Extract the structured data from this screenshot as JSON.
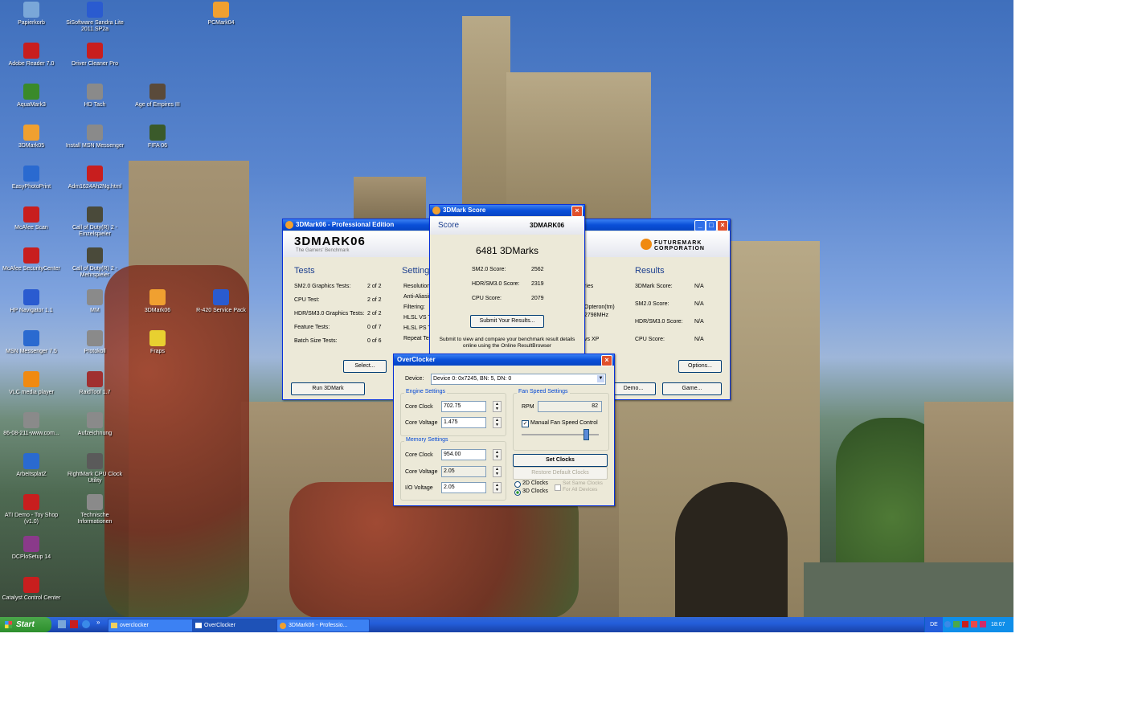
{
  "desktop": {
    "icons": [
      {
        "label": "Papierkorb",
        "color": "#7aa7d8"
      },
      {
        "label": "SiSoftware Sandra Lite 2011.SP2a",
        "color": "#2a5bd0"
      },
      {
        "label": "PCMark04",
        "color": "#f0a030"
      },
      {
        "label": "Adobe Reader 7.0",
        "color": "#c81e1e"
      },
      {
        "label": "Driver Cleaner Pro",
        "color": "#c81e1e"
      },
      {
        "label": "AquaMark3",
        "color": "#3a8a2a"
      },
      {
        "label": "HD Tach",
        "color": "#8a8a8a"
      },
      {
        "label": "Age of Empires III",
        "color": "#5a4a3a"
      },
      {
        "label": "3DMark05",
        "color": "#f0a030"
      },
      {
        "label": "Install MSN Messenger",
        "color": "#8a8a8a"
      },
      {
        "label": "FIFA 06",
        "color": "#3a5a2a"
      },
      {
        "label": "EasyPhotoPrint",
        "color": "#2a6ad0"
      },
      {
        "label": "Adm1624Ah2Ng.html",
        "color": "#c81e1e"
      },
      {
        "label": "McAfee Scan",
        "color": "#c81e1e"
      },
      {
        "label": "Call of Duty(R) 2 - Einzelspieler",
        "color": "#4a4a3a"
      },
      {
        "label": "McAfee SecurityCenter",
        "color": "#c81e1e"
      },
      {
        "label": "Call of Duty(R) 2 - Mehrspieler",
        "color": "#4a4a3a"
      },
      {
        "label": "3DMark06",
        "color": "#f0a030"
      },
      {
        "label": "R-420 Service Pack",
        "color": "#2a5bd0"
      },
      {
        "label": "HP Navigator 1.1",
        "color": "#2a5bd0"
      },
      {
        "label": "MM",
        "color": "#8a8a8a"
      },
      {
        "label": "Fraps",
        "color": "#e8d030"
      },
      {
        "label": "MSN Messenger 7.5",
        "color": "#2a6ad0"
      },
      {
        "label": "Protokoll",
        "color": "#8a8a8a"
      },
      {
        "label": "VLC media player",
        "color": "#f08a10"
      },
      {
        "label": "RaidTool 1.7",
        "color": "#a03030"
      },
      {
        "label": "86-08-211-www.com...",
        "color": "#8a8a8a"
      },
      {
        "label": "Aufzeichnung",
        "color": "#8a8a8a"
      },
      {
        "label": "ArbeitsplatZ",
        "color": "#2a6ad0"
      },
      {
        "label": "RightMark CPU Clock Utility",
        "color": "#5a5a5a"
      },
      {
        "label": "ATI Demo - Toy Shop (v1.0)",
        "color": "#c81e1e"
      },
      {
        "label": "Technische Informationen",
        "color": "#8a8a8a"
      },
      {
        "label": "DCPloSetup 14",
        "color": "#8a3a8a"
      },
      {
        "label": "Catalyst Control Center",
        "color": "#c81e1e"
      }
    ]
  },
  "main_window": {
    "title": "3DMark06 - Professional Edition",
    "logo": "3DMARK06",
    "tagline": "The Gamers' Benchmark",
    "brand": "FUTUREMARK CORPORATION",
    "tests_header": "Tests",
    "tests": [
      {
        "label": "SM2.0 Graphics Tests:",
        "value": "2 of 2"
      },
      {
        "label": "CPU Test:",
        "value": "2 of 2"
      },
      {
        "label": "HDR/SM3.0 Graphics Tests:",
        "value": "2 of 2"
      },
      {
        "label": "Feature Tests:",
        "value": "0 of 7"
      },
      {
        "label": "Batch Size Tests:",
        "value": "0 of 6"
      }
    ],
    "select_button": "Select...",
    "run_button": "Run 3DMark",
    "settings_header": "Settings",
    "settings_labels": [
      "Resolution:",
      "Anti-Aliasing:",
      "Filtering:",
      "HLSL VS T",
      "HLSL PS T",
      "Repeat Te"
    ],
    "system_fragments": [
      "ries",
      "Opteron(tm)",
      "2798MHz",
      "vs XP"
    ],
    "results_header": "Results",
    "results": [
      {
        "label": "3DMark Score:",
        "value": "N/A"
      },
      {
        "label": "SM2.0 Score:",
        "value": "N/A"
      },
      {
        "label": "HDR/SM3.0 Score:",
        "value": "N/A"
      },
      {
        "label": "CPU Score:",
        "value": "N/A"
      }
    ],
    "options_button": "Options...",
    "demo_button": "Demo...",
    "game_button": "Game..."
  },
  "score_window": {
    "title": "3DMark Score",
    "heading": "Score",
    "logo": "3DMARK06",
    "total": "6481 3DMarks",
    "rows": [
      {
        "label": "SM2.0 Score:",
        "value": "2562"
      },
      {
        "label": "HDR/SM3.0 Score:",
        "value": "2319"
      },
      {
        "label": "CPU Score:",
        "value": "2079"
      }
    ],
    "submit_button": "Submit Your Results...",
    "note": "Submit to view and compare your benchmark result details online using the Online ResultBrowser"
  },
  "overclocker": {
    "title": "OverClocker",
    "device_label": "Device:",
    "device_value": "Device 0: 0x7245, BN: 5, DN: 0",
    "engine_group": "Engine Settings",
    "core_clock_label": "Core Clock",
    "core_clock_value": "702.75",
    "core_voltage_label": "Core Voltage",
    "core_voltage_value": "1.475",
    "memory_group": "Memory Settings",
    "mem_clock_label": "Core Clock",
    "mem_clock_value": "954.00",
    "mem_voltage_label": "Core Voltage",
    "mem_voltage_value": "2.05",
    "io_voltage_label": "I/O Voltage",
    "io_voltage_value": "2.05",
    "fan_group": "Fan Speed Settings",
    "rpm_label": "RPM",
    "rpm_value": "82",
    "manual_fan_label": "Manual Fan Speed Control",
    "fan_level": 0.85,
    "set_clocks": "Set Clocks",
    "restore": "Restore Default Clocks",
    "clocks_2d": "2D Clocks",
    "clocks_3d": "3D Clocks",
    "same_clocks": "Set Same Clocks For All Devices"
  },
  "taskbar": {
    "start": "Start",
    "tasks": [
      "overclocker",
      "OverClocker",
      "3DMark06 - Professio..."
    ],
    "lang": "DE",
    "clock": "18:07"
  }
}
